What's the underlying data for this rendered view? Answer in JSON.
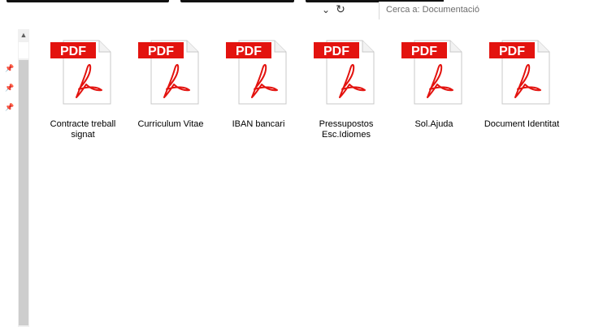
{
  "window": {
    "search": {
      "placeholder": "Cerca a: Documentació"
    }
  },
  "files": [
    {
      "name": "Contracte treball signat",
      "type_label": "PDF",
      "icon": "pdf-file-icon"
    },
    {
      "name": "Curriculum Vitae",
      "type_label": "PDF",
      "icon": "pdf-file-icon"
    },
    {
      "name": "IBAN bancari",
      "type_label": "PDF",
      "icon": "pdf-file-icon"
    },
    {
      "name": "Pressupostos Esc.Idiomes",
      "type_label": "PDF",
      "icon": "pdf-file-icon"
    },
    {
      "name": "Sol.Ajuda",
      "type_label": "PDF",
      "icon": "pdf-file-icon"
    },
    {
      "name": "Document Identitat",
      "type_label": "PDF",
      "icon": "pdf-file-icon"
    }
  ],
  "colors": {
    "pdf_red": "#e3130f",
    "page_bg": "#ffffff",
    "scroll_track": "#cdcdcd"
  }
}
